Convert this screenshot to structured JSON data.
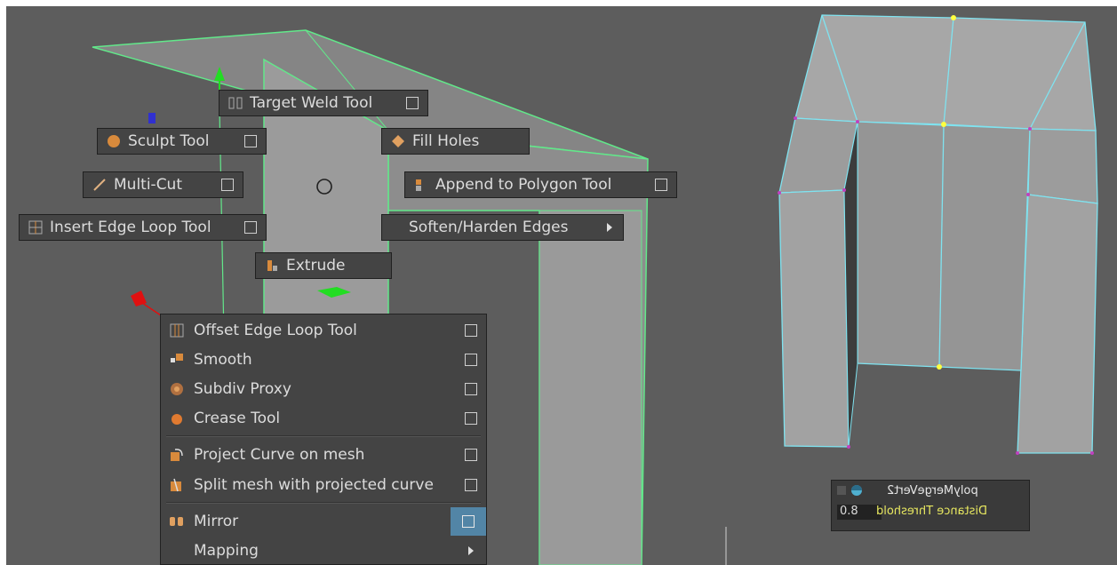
{
  "marking_menu": {
    "target_weld": "Target Weld Tool",
    "sculpt": "Sculpt Tool",
    "fill_holes": "Fill Holes",
    "multi_cut": "Multi-Cut",
    "append_polygon": "Append to Polygon Tool",
    "insert_edge_loop": "Insert Edge Loop Tool",
    "soften_harden": "Soften/Harden Edges",
    "extrude": "Extrude"
  },
  "popup_menu": {
    "items": [
      {
        "label": "Offset Edge Loop Tool",
        "icon": "offset-edge-loop-icon",
        "has_options": true
      },
      {
        "label": "Smooth",
        "icon": "smooth-icon",
        "has_options": true
      },
      {
        "label": "Subdiv Proxy",
        "icon": "subdiv-proxy-icon",
        "has_options": true
      },
      {
        "label": "Crease Tool",
        "icon": "crease-icon",
        "has_options": true
      },
      {
        "label": "Project Curve on mesh",
        "icon": "project-curve-icon",
        "has_options": true
      },
      {
        "label": "Split mesh with projected curve",
        "icon": "split-mesh-icon",
        "has_options": true
      },
      {
        "label": "Mirror",
        "icon": "mirror-icon",
        "has_options": true,
        "highlighted": true
      },
      {
        "label": "Mapping",
        "icon": "",
        "submenu": true
      }
    ]
  },
  "node_panel": {
    "node_name": "polyMergeVert2",
    "attribute_label": "Distance Threshold",
    "attribute_value": "0.8"
  },
  "colors": {
    "viewport_bg": "#5d5d5d",
    "menu_bg": "#444444",
    "highlight": "#5285a6",
    "selection_green": "#62e88a",
    "wire_cyan": "#7fe3f0",
    "vertex_yellow": "#ffff40",
    "vertex_magenta": "#c040c0"
  }
}
